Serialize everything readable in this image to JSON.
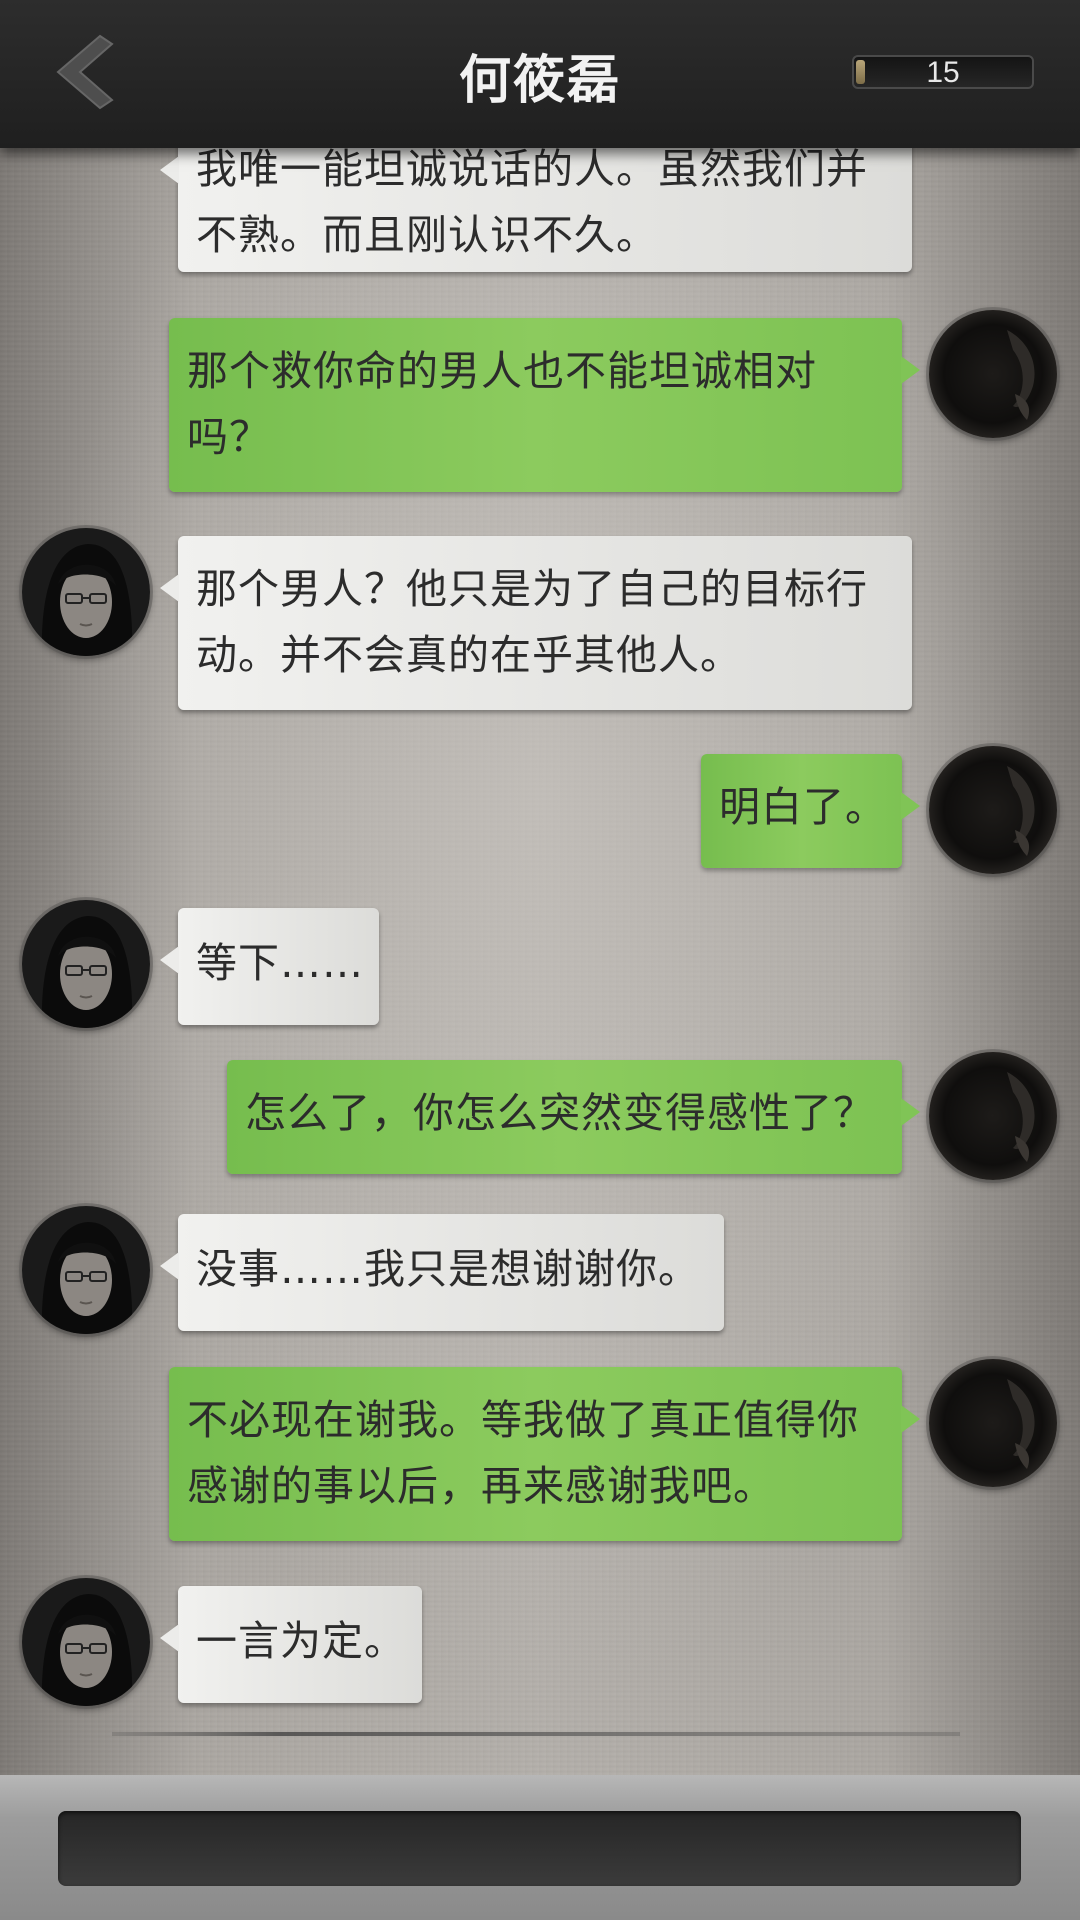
{
  "header": {
    "title": "何筱磊",
    "counter_value": "15",
    "counter_level": 0.05
  },
  "messages": [
    {
      "side": "in",
      "lines": [
        "我唯一能坦诚说话的人。虽然我们并",
        "不熟。而且刚认识不久。"
      ]
    },
    {
      "side": "out",
      "lines": [
        "那个救你命的男人也不能坦诚相对",
        "吗？"
      ]
    },
    {
      "side": "in",
      "lines": [
        "那个男人？他只是为了自己的目标行",
        "动。并不会真的在乎其他人。"
      ]
    },
    {
      "side": "out",
      "lines": [
        "明白了。"
      ]
    },
    {
      "side": "in",
      "lines": [
        "等下……"
      ]
    },
    {
      "side": "out",
      "lines": [
        "怎么了，你怎么突然变得感性了？"
      ]
    },
    {
      "side": "in",
      "lines": [
        "没事……我只是想谢谢你。"
      ]
    },
    {
      "side": "out",
      "lines": [
        "不必现在谢我。等我做了真正值得你",
        "感谢的事以后，再来感谢我吧。"
      ]
    },
    {
      "side": "in",
      "lines": [
        "一言为定。"
      ]
    }
  ],
  "icons": {
    "back": "chevron-left-icon",
    "contact_avatar": "contact-avatar",
    "player_avatar": "player-avatar"
  },
  "colors": {
    "bubble_out": "#82c457",
    "bubble_in": "#e8e8e6",
    "header": "#262626"
  }
}
